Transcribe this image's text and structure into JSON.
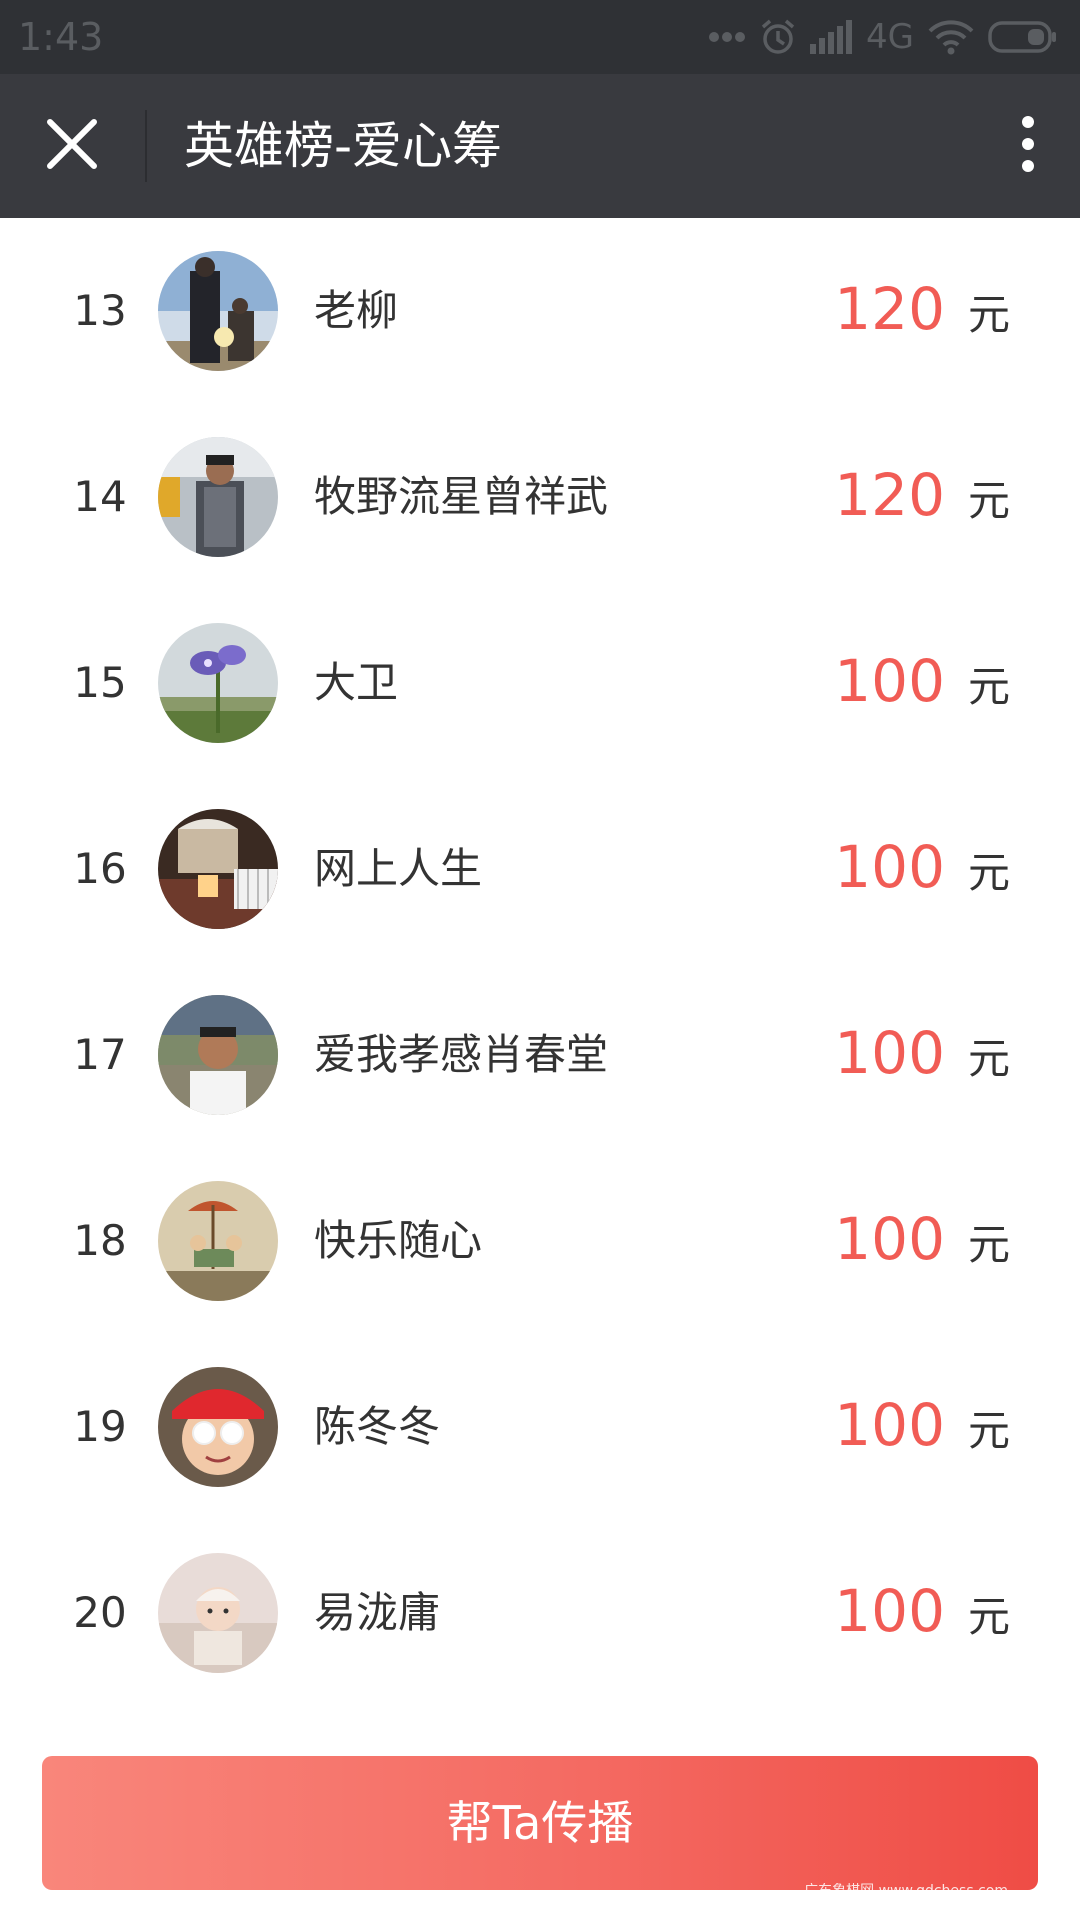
{
  "status_bar": {
    "time": "1:43",
    "network": "4G",
    "icons": [
      "more-dots-icon",
      "alarm-icon",
      "signal-icon",
      "wifi-icon",
      "battery-icon"
    ]
  },
  "header": {
    "title": "英雄榜-爱心筹",
    "close_icon": "close-icon",
    "more_icon": "more-vertical-icon"
  },
  "colors": {
    "status_bar_bg": "#2f3135",
    "title_bar_bg": "#393a3f",
    "amount": "#f15c55",
    "button_gradient_start": "#f9867b",
    "button_gradient_end": "#ef4c45"
  },
  "leaderboard": {
    "rows": [
      {
        "rank": "13",
        "name": "老柳",
        "amount": "120",
        "unit": "元"
      },
      {
        "rank": "14",
        "name": "牧野流星曾祥武",
        "amount": "120",
        "unit": "元"
      },
      {
        "rank": "15",
        "name": "大卫",
        "amount": "100",
        "unit": "元"
      },
      {
        "rank": "16",
        "name": "网上人生",
        "amount": "100",
        "unit": "元"
      },
      {
        "rank": "17",
        "name": "爱我孝感肖春堂",
        "amount": "100",
        "unit": "元"
      },
      {
        "rank": "18",
        "name": "快乐随心",
        "amount": "100",
        "unit": "元"
      },
      {
        "rank": "19",
        "name": "陈冬冬",
        "amount": "100",
        "unit": "元"
      },
      {
        "rank": "20",
        "name": "易泷庸",
        "amount": "100",
        "unit": "元"
      }
    ]
  },
  "footer": {
    "share_label": "帮Ta传播",
    "watermark": "广东象棋网 www.gdchess.com"
  }
}
